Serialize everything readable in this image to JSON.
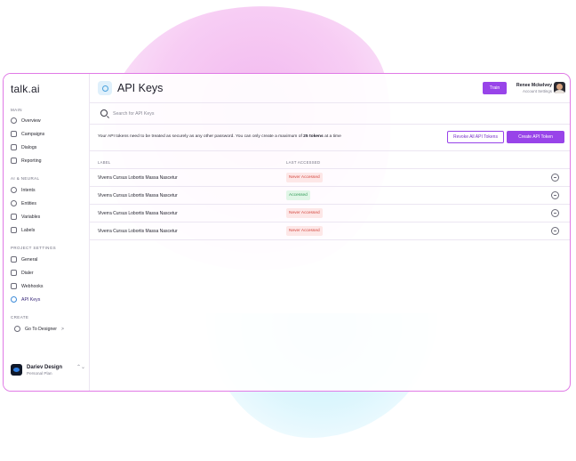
{
  "app": {
    "logo": "talk.ai"
  },
  "colors": {
    "accent": "#9844e9",
    "badge_never_bg": "#fde7e7",
    "badge_never_text": "#d4473f",
    "badge_ok_bg": "#e1f6e7",
    "badge_ok_text": "#2f9a55"
  },
  "sidebar": {
    "sections": [
      {
        "title": "MAIN",
        "items": [
          {
            "label": "Overview",
            "icon": "overview-icon"
          },
          {
            "label": "Campaigns",
            "icon": "campaigns-icon"
          },
          {
            "label": "Dialogs",
            "icon": "dialogs-icon"
          },
          {
            "label": "Reporting",
            "icon": "reporting-icon"
          }
        ]
      },
      {
        "title": "AI & NEURAL",
        "items": [
          {
            "label": "Intents",
            "icon": "intents-icon"
          },
          {
            "label": "Entities",
            "icon": "entities-icon"
          },
          {
            "label": "Variables",
            "icon": "variables-icon"
          },
          {
            "label": "Labels",
            "icon": "labels-icon"
          }
        ]
      },
      {
        "title": "PROJECT SETTINGS",
        "items": [
          {
            "label": "General",
            "icon": "general-icon"
          },
          {
            "label": "Dialer",
            "icon": "dialer-icon"
          },
          {
            "label": "Webhooks",
            "icon": "webhooks-icon"
          },
          {
            "label": "API Keys",
            "icon": "api-keys-icon",
            "active": true
          }
        ]
      },
      {
        "title": "CREATE",
        "items": [
          {
            "label": "Go To Designer",
            "icon": "designer-icon",
            "chevron": ">"
          }
        ]
      }
    ],
    "workspace": {
      "name": "Dariev Design",
      "plan": "Personal Plan",
      "toggle": "⌃⌄"
    }
  },
  "header": {
    "title": "API Keys",
    "train_label": "Train",
    "user": {
      "name": "Renee Mckelvey",
      "subtitle": "Account Settings"
    }
  },
  "search": {
    "placeholder": "Search for API Keys",
    "value": ""
  },
  "info": {
    "text_before": "Your API tokens need to be treated as securely as any other password. You can only create a maximum of ",
    "text_bold": "25 tokens",
    "text_after": " at a time",
    "revoke_label": "Revoke All API Tokens",
    "create_label": "Create API Token"
  },
  "table": {
    "columns": {
      "label": "LABEL",
      "last_accessed": "LAST ACCESSED"
    },
    "rows": [
      {
        "label": "Viverra Cursus Lobortis Massa Nascetur",
        "status": "Never Accessed",
        "status_type": "never"
      },
      {
        "label": "Viverra Cursus Lobortis Massa Nascetur",
        "status": "Accessed",
        "status_type": "ok"
      },
      {
        "label": "Viverra Cursus Lobortis Massa Nascetur",
        "status": "Never Accessed",
        "status_type": "never"
      },
      {
        "label": "Viverra Cursus Lobortis Massa Nascetur",
        "status": "Never Accessed",
        "status_type": "never"
      }
    ]
  }
}
